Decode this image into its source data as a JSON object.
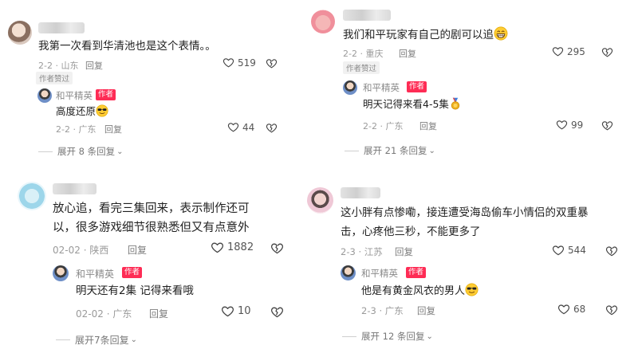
{
  "panels": [
    {
      "comment": "我第一次看到华清池也是这个表情。。",
      "date": "2-2",
      "location": "山东",
      "reply_label": "回复",
      "likes": "519",
      "badge": "作者赞过",
      "author_reply": {
        "name": "和平精英",
        "tag": "作者",
        "text": "高度还原",
        "emoji": "cool-sunglasses",
        "date": "2-2",
        "location": "广东",
        "reply_label": "回复",
        "likes": "44"
      },
      "expand": "展开 8 条回复"
    },
    {
      "comment": "我们和平玩家有自己的剧可以追",
      "comment_emoji": "grin",
      "date": "2-2",
      "location": "重庆",
      "reply_label": "回复",
      "likes": "295",
      "badge": "作者赞过",
      "author_reply": {
        "name": "和平精英",
        "tag": "作者",
        "text": "明天记得来看4-5集",
        "emoji": "medal",
        "date": "2-2",
        "location": "广东",
        "reply_label": "回复",
        "likes": "99"
      },
      "expand": "展开 21 条回复"
    },
    {
      "comment_line1": "放心追，看完三集回来，表示制作还可",
      "comment_line2": "以，很多游戏细节很熟悉但又有点意外",
      "date": "02-02",
      "location": "陕西",
      "reply_label": "回复",
      "likes": "1882",
      "author_reply": {
        "name": "和平精英",
        "tag": "作者",
        "text": "明天还有2集 记得来看哦",
        "date": "02-02",
        "location": "广东",
        "reply_label": "回复",
        "likes": "10"
      },
      "expand": "展开7条回复"
    },
    {
      "comment_line1": "这小胖有点惨嘞，接连遭受海岛偷车小情侣的双重暴",
      "comment_line2": "击，心疼他三秒，不能更多了",
      "date": "2-3",
      "location": "江苏",
      "reply_label": "回复",
      "likes": "544",
      "author_reply": {
        "name": "和平精英",
        "tag": "作者",
        "text": "他是有黄金风衣的男人",
        "emoji": "cool-sunglasses",
        "date": "2-3",
        "location": "广东",
        "reply_label": "回复",
        "likes": "68"
      },
      "expand": "展开 12 条回复"
    }
  ],
  "colors": {
    "author_tag": "#fe2c55",
    "meta": "#9a9a9a"
  }
}
